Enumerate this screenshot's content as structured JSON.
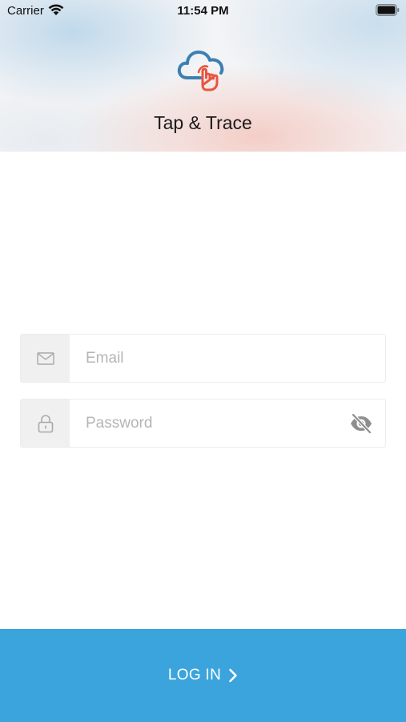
{
  "status_bar": {
    "carrier": "Carrier",
    "time": "11:54 PM"
  },
  "header": {
    "app_title": "Tap & Trace",
    "logo_icon": "cloud-with-tapping-hand-icon",
    "logo_colors": {
      "cloud": "#3d7fb3",
      "hand": "#e8553f"
    }
  },
  "form": {
    "email": {
      "placeholder": "Email",
      "value": "",
      "icon": "envelope-icon"
    },
    "password": {
      "placeholder": "Password",
      "value": "",
      "icon": "lock-icon",
      "toggle_icon": "eye-slash-icon"
    }
  },
  "login_button": {
    "label": "LOG IN",
    "icon": "chevron-right-icon",
    "color": "#3ba4dd"
  }
}
